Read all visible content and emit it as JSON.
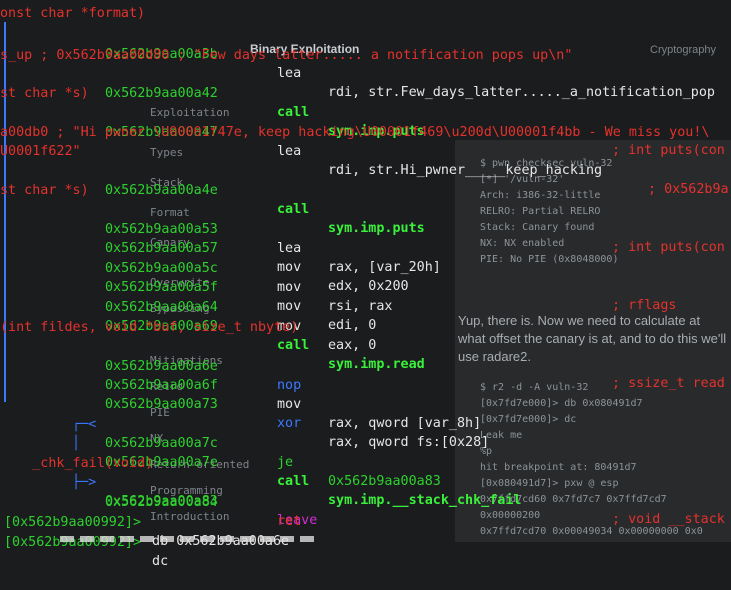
{
  "ghost": {
    "tab_title": "Binary Exploitation",
    "right_tab": "Cryptography",
    "sidebar": [
      "Exploitation",
      "Types",
      "Stack",
      "Format",
      "Canary",
      "Overwrite",
      "Bypassing",
      "Mitigations",
      "Relro",
      "PIE",
      "NX",
      "Return-oriented",
      "Programming",
      "Introduction"
    ],
    "checksec_lines": [
      "$ pwn checksec vuln-32",
      "[*] '/vuln-32'",
      "    Arch:     i386-32-little",
      "    RELRO:    Partial RELRO",
      "    Stack:    Canary found",
      "    NX:       NX enabled",
      "    PIE:      No PIE (0x8048000)"
    ],
    "body_text": "Yup, there is. Now we need to calculate at what offset the canary is at, and to do this we'll use radare2.",
    "r2_lines": [
      "$ r2 -d -A vuln-32",
      "[0x7fd7e000]> db 0x080491d7",
      "[0x7fd7e000]> dc",
      "Leak me",
      "%p",
      "hit breakpoint at: 80491d7",
      "[0x080491d7]> pxw @ esp",
      "0x7ffd7cd60  0x7fd7c7 0x7ffd7cd7 0x00000200",
      "0x7ffd7cd70  0x00049034 0x00000000 0x0"
    ]
  },
  "terminal": {
    "top_cut": "onst char *format)",
    "lines": [
      {
        "addr": "0x562b9aa00a3b",
        "op": "lea",
        "args": "rdi, str.Few_days_latter....._a_notification_pop"
      },
      {
        "cont": "s_up ; 0x562b9aa00d80 ; \"Few days latter..... a notification pops up\\n\""
      },
      {
        "addr": "0x562b9aa00a42",
        "op": "call",
        "args": "sym.imp.puts",
        "comment": "; int puts(con"
      },
      {
        "cont": "st char *s)"
      },
      {
        "addr": "0x562b9aa00a47",
        "op": "lea",
        "args": "rdi, str.Hi_pwner_____keep_hacking",
        "comment2": "; 0x562b9a"
      },
      {
        "cont": "a00db0 ; \"Hi pwner \\U00001f47e, keep hacking\\U00001f469\\u200d\\U00001f4bb - We miss you!\\"
      },
      {
        "cont": "U0001f622\""
      },
      {
        "addr": "0x562b9aa00a4e",
        "op": "call",
        "args": "sym.imp.puts",
        "comment": "; int puts(con"
      },
      {
        "cont": "st char *s)"
      },
      {
        "addr": "0x562b9aa00a53",
        "op": "lea",
        "args": "rax, [var_20h]"
      },
      {
        "addr": "0x562b9aa00a57",
        "op": "mov",
        "args": "edx, 0x200",
        "comment": "; rflags"
      },
      {
        "addr": "0x562b9aa00a5c",
        "op": "mov",
        "args": "rsi, rax"
      },
      {
        "addr": "0x562b9aa00a5f",
        "op": "mov",
        "args": "edi, 0"
      },
      {
        "addr": "0x562b9aa00a64",
        "op": "mov",
        "args": "eax, 0"
      },
      {
        "addr": "0x562b9aa00a69",
        "op": "call",
        "args": "sym.imp.read",
        "comment": "; ssize_t read"
      },
      {
        "cont": "(int fildes, void *buf, size_t nbyte)"
      },
      {
        "addr": "0x562b9aa00a6e",
        "op": "nop",
        "args": ""
      },
      {
        "addr": "0x562b9aa00a6f",
        "op": "mov",
        "args": "rax, qword [var_8h]"
      },
      {
        "addr": "0x562b9aa00a73",
        "op": "xor",
        "args": "rax, qword fs:[0x28]"
      },
      {
        "addr": "0x562b9aa00a7c",
        "op": "je",
        "args": "0x562b9aa00a83"
      },
      {
        "addr": "0x562b9aa00a7e",
        "op": "call",
        "args": "sym.imp.__stack_chk_fail",
        "comment": "; void __stack"
      },
      {
        "cont": "_chk_fail(void)"
      },
      {
        "addr": "0x562b9aa00a83",
        "op": "leave",
        "args": ""
      },
      {
        "addr": "0x562b9aa00a84",
        "op": "ret",
        "args": ""
      }
    ],
    "prompts": [
      {
        "prompt": "[0x562b9aa00992]>",
        "cmd": " db 0x562b9aa00a6e"
      },
      {
        "prompt": "[0x562b9aa00992]>",
        "cmd": " dc"
      }
    ],
    "arrows": {
      "je_arrow": "┌─<",
      "je_pipe": "│",
      "fail_arrow": "└─>"
    },
    "colors": {
      "background": "#1a1c1e",
      "address": "#2fd12f",
      "comment": "#e5322c",
      "call": "#3bf03b",
      "bar": "#3b78ff",
      "leave": "#d02fd0"
    }
  }
}
